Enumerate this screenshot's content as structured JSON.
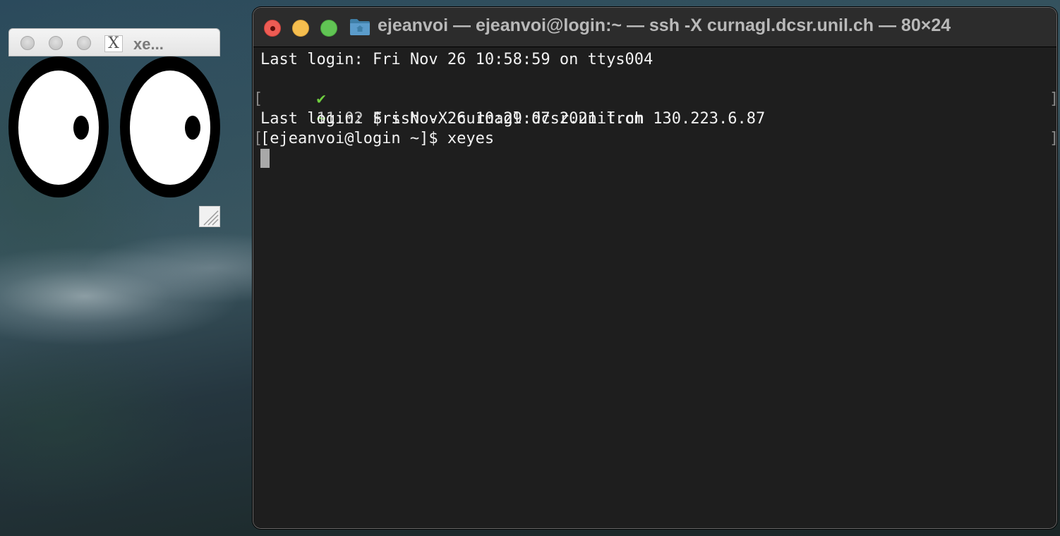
{
  "xeyes_window": {
    "title": "xe...",
    "logo_text": "X"
  },
  "terminal": {
    "title": "ejeanvoi — ejeanvoi@login:~ — ssh -X curnagl.dcsr.unil.ch — 80×24",
    "lines": {
      "l1": "Last login: Fri Nov 26 10:58:59 on ttys004",
      "l2_check": "✔",
      "l2_tilde": "~",
      "l3_time": "11:02",
      "l3_cmd": " $ ssh -X curnagl.dcsr.unil.ch",
      "l4": "Last login: Fri Nov 26 10:29:07 2021 from 130.223.6.87",
      "l5": "[ejeanvoi@login ~]$ xeyes"
    },
    "brackets": {
      "left": "[",
      "right": "]"
    }
  },
  "icons": {
    "folder": "folder-icon",
    "x_logo": "x11-logo-icon",
    "resize": "resize-grip-icon"
  },
  "colors": {
    "terminal_bg": "#1e1e1e",
    "close": "#ee5c54",
    "minimize": "#f5be4f",
    "maximize": "#61c554",
    "prompt_check": "#6fcf3f"
  }
}
